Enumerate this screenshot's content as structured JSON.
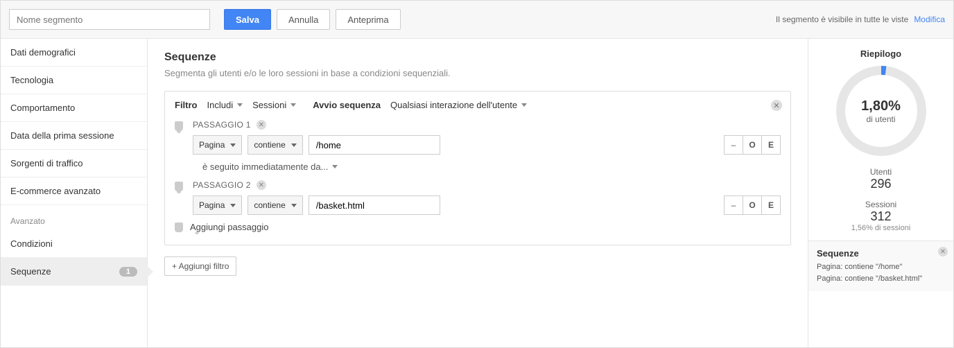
{
  "toolbar": {
    "segment_name_placeholder": "Nome segmento",
    "save": "Salva",
    "cancel": "Annulla",
    "preview": "Anteprima",
    "visibility": "Il segmento è visibile in tutte le viste",
    "modify": "Modifica"
  },
  "sidebar": {
    "items": [
      "Dati demografici",
      "Tecnologia",
      "Comportamento",
      "Data della prima sessione",
      "Sorgenti di traffico",
      "E-commerce avanzato"
    ],
    "advanced_label": "Avanzato",
    "advanced_items": [
      {
        "label": "Condizioni",
        "badge": ""
      },
      {
        "label": "Sequenze",
        "badge": "1"
      }
    ]
  },
  "main": {
    "title": "Sequenze",
    "subtitle": "Segmenta gli utenti e/o le loro sessioni in base a condizioni sequenziali.",
    "filter_label": "Filtro",
    "filter_include": "Includi",
    "filter_scope": "Sessioni",
    "start_label": "Avvio sequenza",
    "start_value": "Qualsiasi interazione dell'utente",
    "steps": [
      {
        "title": "PASSAGGIO 1",
        "dimension": "Pagina",
        "match": "contiene",
        "value": "/home"
      },
      {
        "title": "PASSAGGIO 2",
        "dimension": "Pagina",
        "match": "contiene",
        "value": "/basket.html"
      }
    ],
    "connector": "è seguito immediatamente da...",
    "mini_remove": "–",
    "mini_or": "O",
    "mini_and": "E",
    "add_step": "Aggiungi passaggio",
    "add_filter": "+ Aggiungi filtro"
  },
  "summary": {
    "title": "Riepilogo",
    "pct": "1,80%",
    "pct_sub": "di utenti",
    "users_label": "Utenti",
    "users_value": "296",
    "sessions_label": "Sessioni",
    "sessions_value": "312",
    "sessions_sub": "1,56% di sessioni",
    "card_title": "Sequenze",
    "card_line1": "Pagina: contiene \"/home\"",
    "card_line2": "Pagina: contiene \"/basket.html\""
  }
}
